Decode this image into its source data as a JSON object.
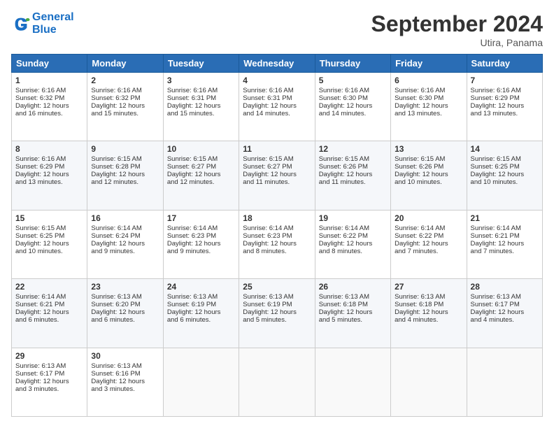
{
  "header": {
    "logo_line1": "General",
    "logo_line2": "Blue",
    "month_title": "September 2024",
    "location": "Utira, Panama"
  },
  "days_of_week": [
    "Sunday",
    "Monday",
    "Tuesday",
    "Wednesday",
    "Thursday",
    "Friday",
    "Saturday"
  ],
  "weeks": [
    [
      {
        "day": "1",
        "lines": [
          "Sunrise: 6:16 AM",
          "Sunset: 6:32 PM",
          "Daylight: 12 hours",
          "and 16 minutes."
        ]
      },
      {
        "day": "2",
        "lines": [
          "Sunrise: 6:16 AM",
          "Sunset: 6:32 PM",
          "Daylight: 12 hours",
          "and 15 minutes."
        ]
      },
      {
        "day": "3",
        "lines": [
          "Sunrise: 6:16 AM",
          "Sunset: 6:31 PM",
          "Daylight: 12 hours",
          "and 15 minutes."
        ]
      },
      {
        "day": "4",
        "lines": [
          "Sunrise: 6:16 AM",
          "Sunset: 6:31 PM",
          "Daylight: 12 hours",
          "and 14 minutes."
        ]
      },
      {
        "day": "5",
        "lines": [
          "Sunrise: 6:16 AM",
          "Sunset: 6:30 PM",
          "Daylight: 12 hours",
          "and 14 minutes."
        ]
      },
      {
        "day": "6",
        "lines": [
          "Sunrise: 6:16 AM",
          "Sunset: 6:30 PM",
          "Daylight: 12 hours",
          "and 13 minutes."
        ]
      },
      {
        "day": "7",
        "lines": [
          "Sunrise: 6:16 AM",
          "Sunset: 6:29 PM",
          "Daylight: 12 hours",
          "and 13 minutes."
        ]
      }
    ],
    [
      {
        "day": "8",
        "lines": [
          "Sunrise: 6:16 AM",
          "Sunset: 6:29 PM",
          "Daylight: 12 hours",
          "and 13 minutes."
        ]
      },
      {
        "day": "9",
        "lines": [
          "Sunrise: 6:15 AM",
          "Sunset: 6:28 PM",
          "Daylight: 12 hours",
          "and 12 minutes."
        ]
      },
      {
        "day": "10",
        "lines": [
          "Sunrise: 6:15 AM",
          "Sunset: 6:27 PM",
          "Daylight: 12 hours",
          "and 12 minutes."
        ]
      },
      {
        "day": "11",
        "lines": [
          "Sunrise: 6:15 AM",
          "Sunset: 6:27 PM",
          "Daylight: 12 hours",
          "and 11 minutes."
        ]
      },
      {
        "day": "12",
        "lines": [
          "Sunrise: 6:15 AM",
          "Sunset: 6:26 PM",
          "Daylight: 12 hours",
          "and 11 minutes."
        ]
      },
      {
        "day": "13",
        "lines": [
          "Sunrise: 6:15 AM",
          "Sunset: 6:26 PM",
          "Daylight: 12 hours",
          "and 10 minutes."
        ]
      },
      {
        "day": "14",
        "lines": [
          "Sunrise: 6:15 AM",
          "Sunset: 6:25 PM",
          "Daylight: 12 hours",
          "and 10 minutes."
        ]
      }
    ],
    [
      {
        "day": "15",
        "lines": [
          "Sunrise: 6:15 AM",
          "Sunset: 6:25 PM",
          "Daylight: 12 hours",
          "and 10 minutes."
        ]
      },
      {
        "day": "16",
        "lines": [
          "Sunrise: 6:14 AM",
          "Sunset: 6:24 PM",
          "Daylight: 12 hours",
          "and 9 minutes."
        ]
      },
      {
        "day": "17",
        "lines": [
          "Sunrise: 6:14 AM",
          "Sunset: 6:23 PM",
          "Daylight: 12 hours",
          "and 9 minutes."
        ]
      },
      {
        "day": "18",
        "lines": [
          "Sunrise: 6:14 AM",
          "Sunset: 6:23 PM",
          "Daylight: 12 hours",
          "and 8 minutes."
        ]
      },
      {
        "day": "19",
        "lines": [
          "Sunrise: 6:14 AM",
          "Sunset: 6:22 PM",
          "Daylight: 12 hours",
          "and 8 minutes."
        ]
      },
      {
        "day": "20",
        "lines": [
          "Sunrise: 6:14 AM",
          "Sunset: 6:22 PM",
          "Daylight: 12 hours",
          "and 7 minutes."
        ]
      },
      {
        "day": "21",
        "lines": [
          "Sunrise: 6:14 AM",
          "Sunset: 6:21 PM",
          "Daylight: 12 hours",
          "and 7 minutes."
        ]
      }
    ],
    [
      {
        "day": "22",
        "lines": [
          "Sunrise: 6:14 AM",
          "Sunset: 6:21 PM",
          "Daylight: 12 hours",
          "and 6 minutes."
        ]
      },
      {
        "day": "23",
        "lines": [
          "Sunrise: 6:13 AM",
          "Sunset: 6:20 PM",
          "Daylight: 12 hours",
          "and 6 minutes."
        ]
      },
      {
        "day": "24",
        "lines": [
          "Sunrise: 6:13 AM",
          "Sunset: 6:19 PM",
          "Daylight: 12 hours",
          "and 6 minutes."
        ]
      },
      {
        "day": "25",
        "lines": [
          "Sunrise: 6:13 AM",
          "Sunset: 6:19 PM",
          "Daylight: 12 hours",
          "and 5 minutes."
        ]
      },
      {
        "day": "26",
        "lines": [
          "Sunrise: 6:13 AM",
          "Sunset: 6:18 PM",
          "Daylight: 12 hours",
          "and 5 minutes."
        ]
      },
      {
        "day": "27",
        "lines": [
          "Sunrise: 6:13 AM",
          "Sunset: 6:18 PM",
          "Daylight: 12 hours",
          "and 4 minutes."
        ]
      },
      {
        "day": "28",
        "lines": [
          "Sunrise: 6:13 AM",
          "Sunset: 6:17 PM",
          "Daylight: 12 hours",
          "and 4 minutes."
        ]
      }
    ],
    [
      {
        "day": "29",
        "lines": [
          "Sunrise: 6:13 AM",
          "Sunset: 6:17 PM",
          "Daylight: 12 hours",
          "and 3 minutes."
        ]
      },
      {
        "day": "30",
        "lines": [
          "Sunrise: 6:13 AM",
          "Sunset: 6:16 PM",
          "Daylight: 12 hours",
          "and 3 minutes."
        ]
      },
      {
        "day": "",
        "lines": []
      },
      {
        "day": "",
        "lines": []
      },
      {
        "day": "",
        "lines": []
      },
      {
        "day": "",
        "lines": []
      },
      {
        "day": "",
        "lines": []
      }
    ]
  ]
}
